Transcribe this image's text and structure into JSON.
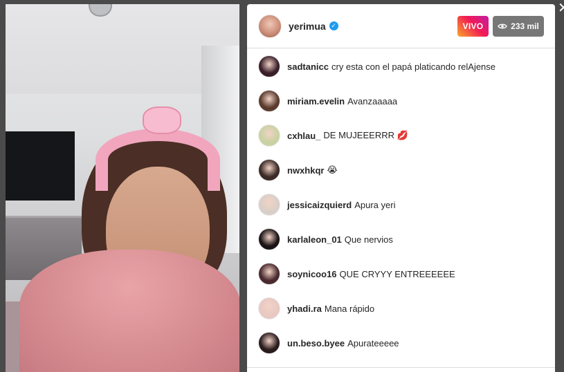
{
  "stream": {
    "username": "yerimua",
    "live_label": "VIVO",
    "viewers": "233 mil"
  },
  "comments": [
    {
      "user": "sadtanicc",
      "text": "cry esta con el papá platicando relAjense",
      "avatar_color": "#3a1f2a"
    },
    {
      "user": "miriam.evelin",
      "text": "Avanzaaaaa",
      "avatar_color": "#5a3a2c"
    },
    {
      "user": "cxhlau_",
      "text": "DE MUJEEERRR 💋",
      "avatar_color": "#c9d2a3"
    },
    {
      "user": "nwxhkqr",
      "text": "😭",
      "avatar_color": "#3b2a26"
    },
    {
      "user": "jessicaizquierd",
      "text": "Apura yeri",
      "avatar_color": "#d9cfc8"
    },
    {
      "user": "karlaleon_01",
      "text": "Que nervios",
      "avatar_color": "#1b1416"
    },
    {
      "user": "soynicoo16",
      "text": "QUE CRYYY ENTREEEEEE",
      "avatar_color": "#4a2a2f"
    },
    {
      "user": "yhadi.ra",
      "text": "Mana rápido",
      "avatar_color": "#e8c8c2"
    },
    {
      "user": "un.beso.byee",
      "text": "Apurateeeee",
      "avatar_color": "#2a1c1d"
    }
  ],
  "colors": {
    "live_gradient": [
      "#f9a72b",
      "#f21a56",
      "#c11ea5"
    ],
    "verified": "#1d9bf0",
    "viewer_pill": "#777778"
  },
  "icons": {
    "verified": "verified-badge-icon",
    "eye": "eye-icon",
    "close": "close-icon"
  }
}
